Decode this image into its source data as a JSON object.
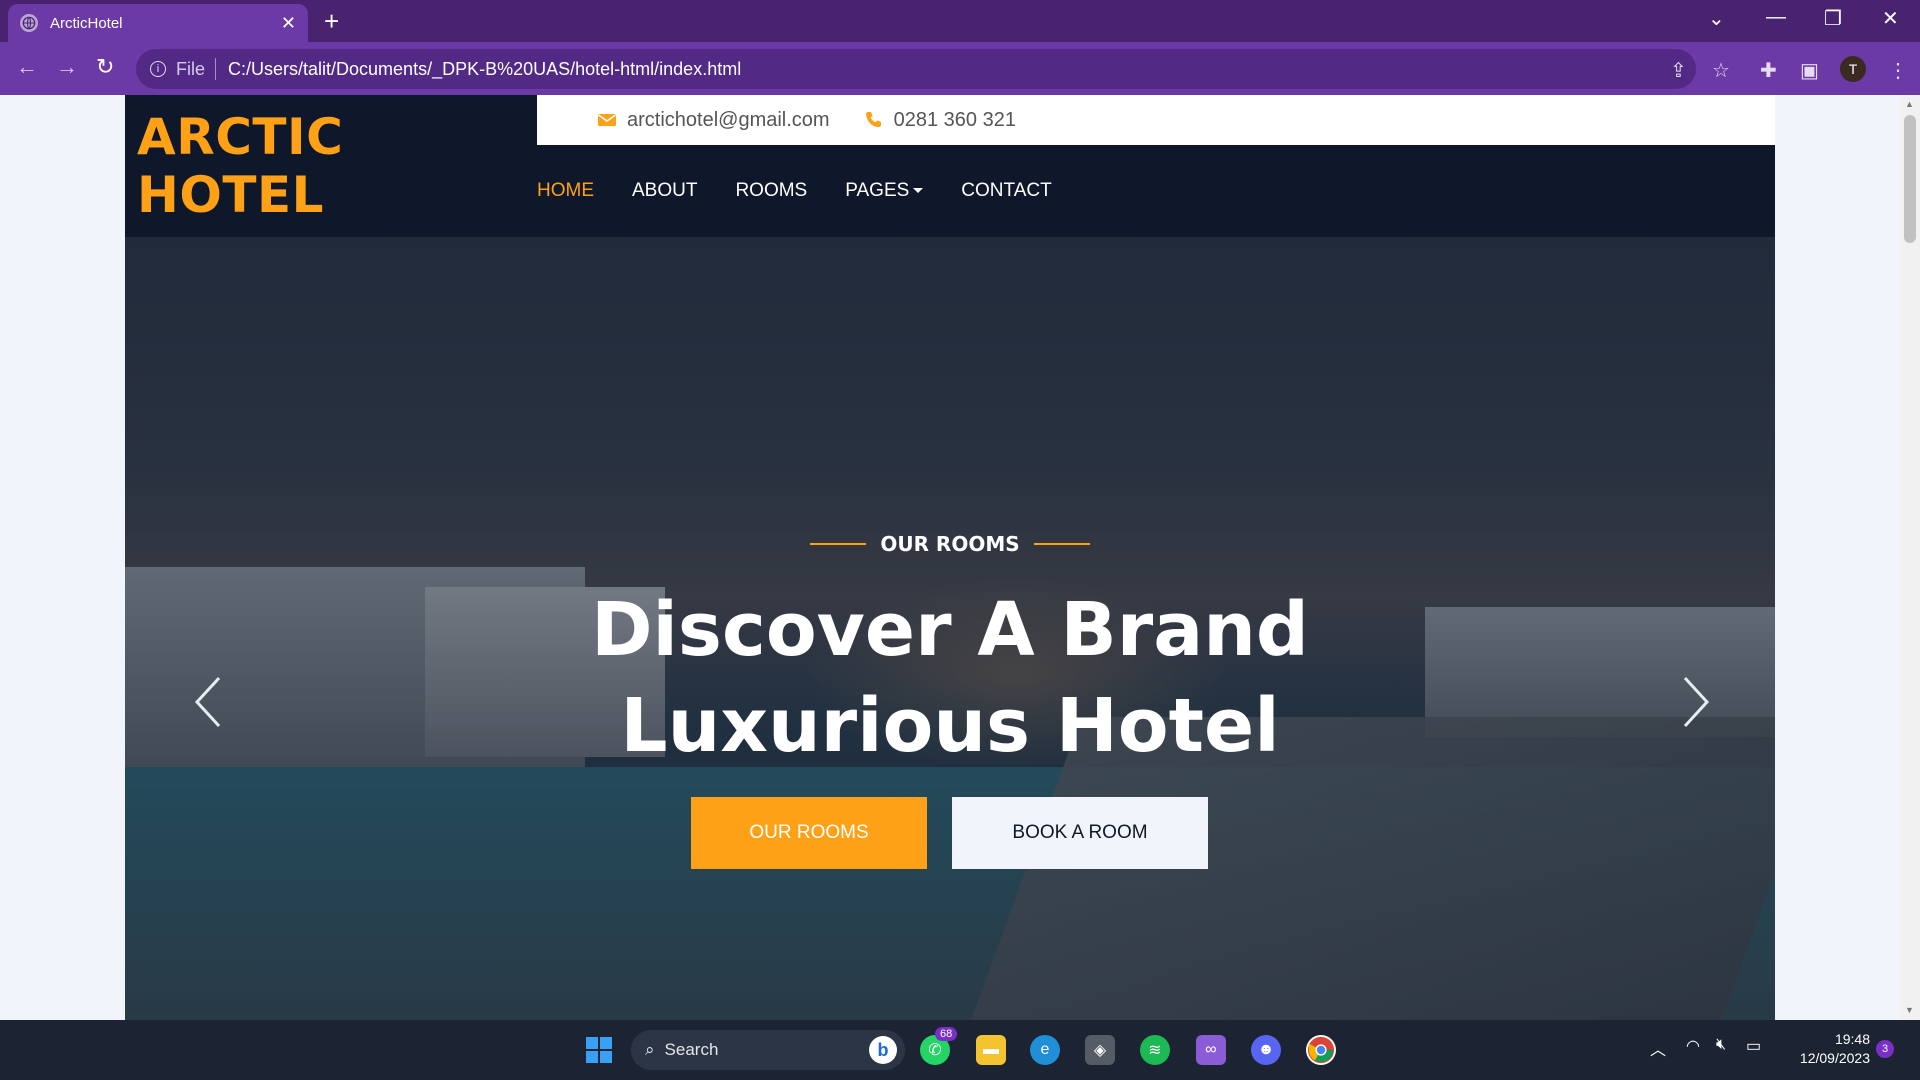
{
  "browser": {
    "tab_title": "ArcticHotel",
    "new_tab": "+",
    "file_label": "File",
    "url": "C:/Users/talit/Documents/_DPK-B%20UAS/hotel-html/index.html",
    "profile_initial": "T"
  },
  "site": {
    "brand": "ARCTIC HOTEL",
    "contact": {
      "email": "arctichotel@gmail.com",
      "phone": "0281 360 321"
    },
    "nav": [
      {
        "label": "HOME",
        "active": true
      },
      {
        "label": "ABOUT",
        "active": false
      },
      {
        "label": "ROOMS",
        "active": false
      },
      {
        "label": "PAGES",
        "active": false,
        "dropdown": true
      },
      {
        "label": "CONTACT",
        "active": false
      }
    ],
    "accent_color": "#fea116",
    "dark_color": "#0f172b"
  },
  "hero": {
    "eyebrow": "OUR ROOMS",
    "headline_line1": "Discover A Brand",
    "headline_line2": "Luxurious Hotel",
    "primary_button": "OUR ROOMS",
    "secondary_button": "BOOK A ROOM"
  },
  "taskbar": {
    "search_placeholder": "Search",
    "whatsapp_badge": "68",
    "time": "19:48",
    "date": "12/09/2023",
    "notification_count": "3",
    "apps": [
      "windows-start",
      "whatsapp",
      "file-explorer",
      "edge",
      "unity",
      "spotify",
      "visual-studio",
      "discord",
      "chrome"
    ]
  }
}
